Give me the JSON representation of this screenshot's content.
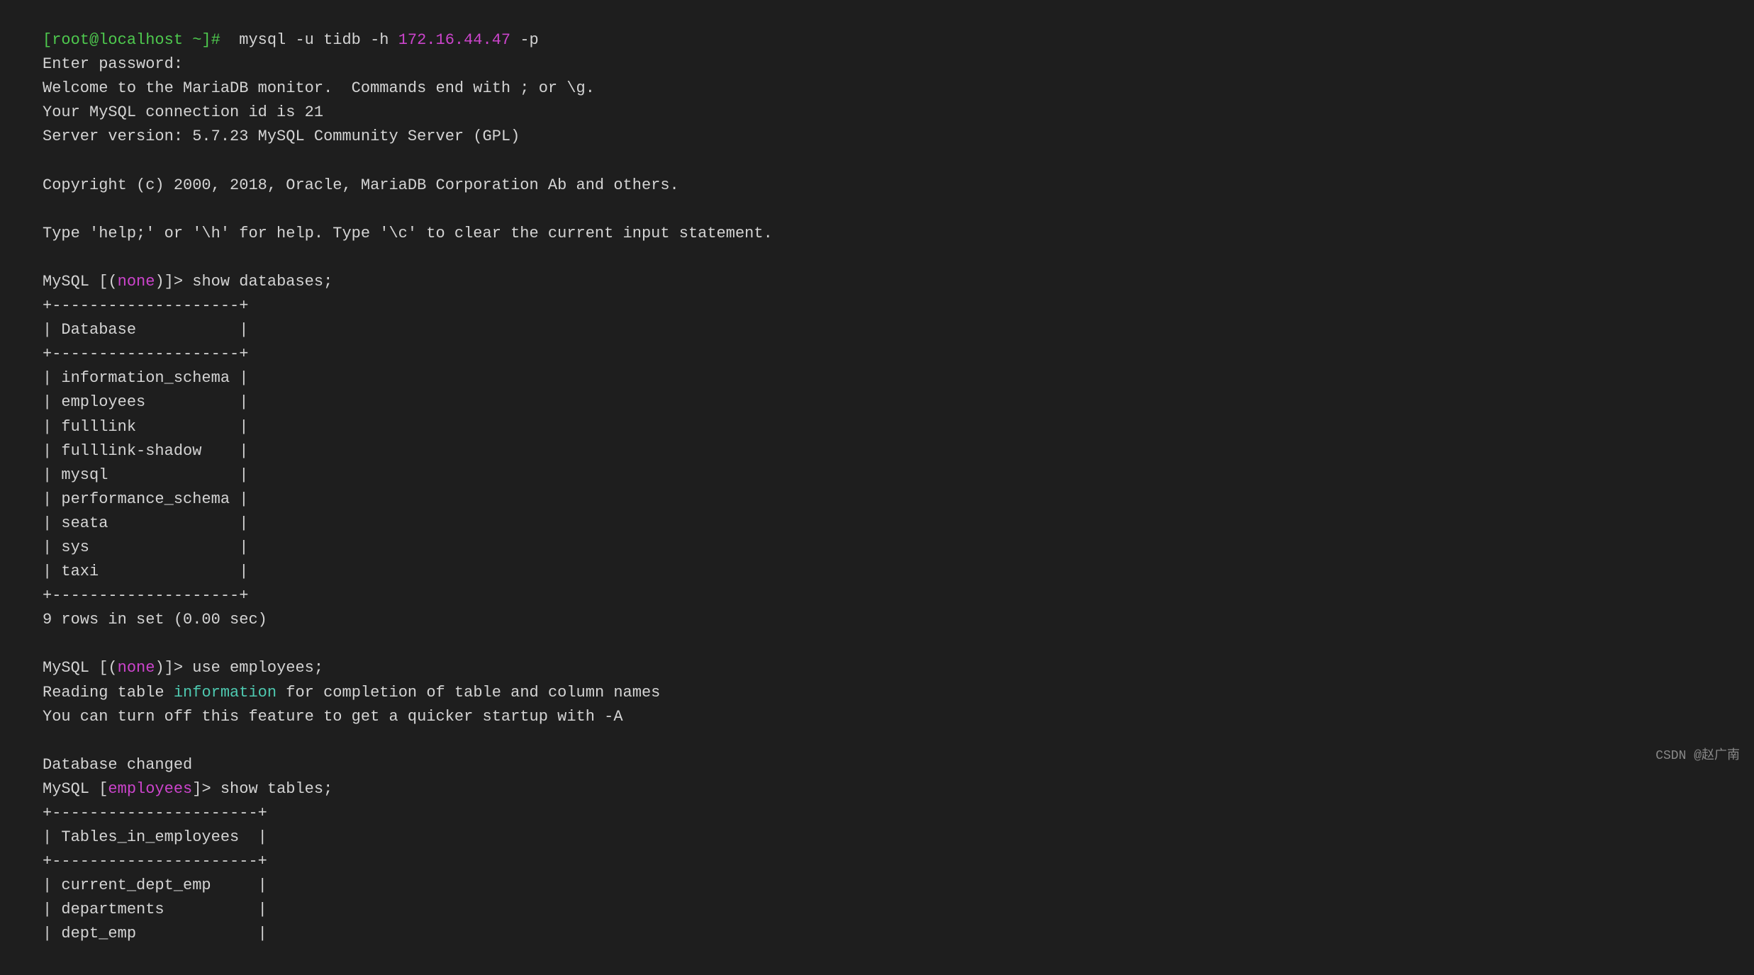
{
  "terminal": {
    "lines": [
      {
        "type": "command",
        "content": "[root@localhost ~]#  mysql -u tidb -h 172.16.44.47 -p"
      },
      {
        "type": "output",
        "content": "Enter password:"
      },
      {
        "type": "output",
        "content": "Welcome to the MariaDB monitor.  Commands end with ; or \\g."
      },
      {
        "type": "output",
        "content": "Your MySQL connection id is 21"
      },
      {
        "type": "output",
        "content": "Server version: 5.7.23 MySQL Community Server (GPL)"
      },
      {
        "type": "blank"
      },
      {
        "type": "output",
        "content": "Copyright (c) 2000, 2018, Oracle, MariaDB Corporation Ab and others."
      },
      {
        "type": "blank"
      },
      {
        "type": "output",
        "content": "Type 'help;' or '\\h' for help. Type '\\c' to clear the current input statement."
      },
      {
        "type": "blank"
      },
      {
        "type": "mysql_command",
        "db": "none",
        "content": "show databases;"
      },
      {
        "type": "output",
        "content": "+--------------------+"
      },
      {
        "type": "output",
        "content": "| Database           |"
      },
      {
        "type": "output",
        "content": "+--------------------+"
      },
      {
        "type": "output",
        "content": "| information_schema |"
      },
      {
        "type": "output",
        "content": "| employees          |"
      },
      {
        "type": "output",
        "content": "| fulllink           |"
      },
      {
        "type": "output",
        "content": "| fulllink-shadow    |"
      },
      {
        "type": "output",
        "content": "| mysql              |"
      },
      {
        "type": "output",
        "content": "| performance_schema |"
      },
      {
        "type": "output",
        "content": "| seata              |"
      },
      {
        "type": "output",
        "content": "| sys                |"
      },
      {
        "type": "output",
        "content": "| taxi               |"
      },
      {
        "type": "output",
        "content": "+--------------------+"
      },
      {
        "type": "output",
        "content": "9 rows in set (0.00 sec)"
      },
      {
        "type": "blank"
      },
      {
        "type": "mysql_command",
        "db": "none",
        "content": "use employees;"
      },
      {
        "type": "output_mixed",
        "parts": [
          {
            "text": "Reading table ",
            "color": "normal"
          },
          {
            "text": "information",
            "color": "cyan"
          },
          {
            "text": " for completion of table and column names",
            "color": "normal"
          }
        ]
      },
      {
        "type": "output",
        "content": "You can turn off this feature to get a quicker startup with -A"
      },
      {
        "type": "blank"
      },
      {
        "type": "output",
        "content": "Database changed"
      },
      {
        "type": "mysql_command",
        "db": "employees",
        "content": "show tables;"
      },
      {
        "type": "output",
        "content": "+----------------------+"
      },
      {
        "type": "output",
        "content": "| Tables_in_employees  |"
      },
      {
        "type": "output",
        "content": "+----------------------+"
      },
      {
        "type": "output",
        "content": "| current_dept_emp     |"
      },
      {
        "type": "output",
        "content": "| departments          |"
      },
      {
        "type": "output",
        "content": "| dept_emp             |"
      }
    ],
    "watermark": "CSDN @赵广南"
  }
}
